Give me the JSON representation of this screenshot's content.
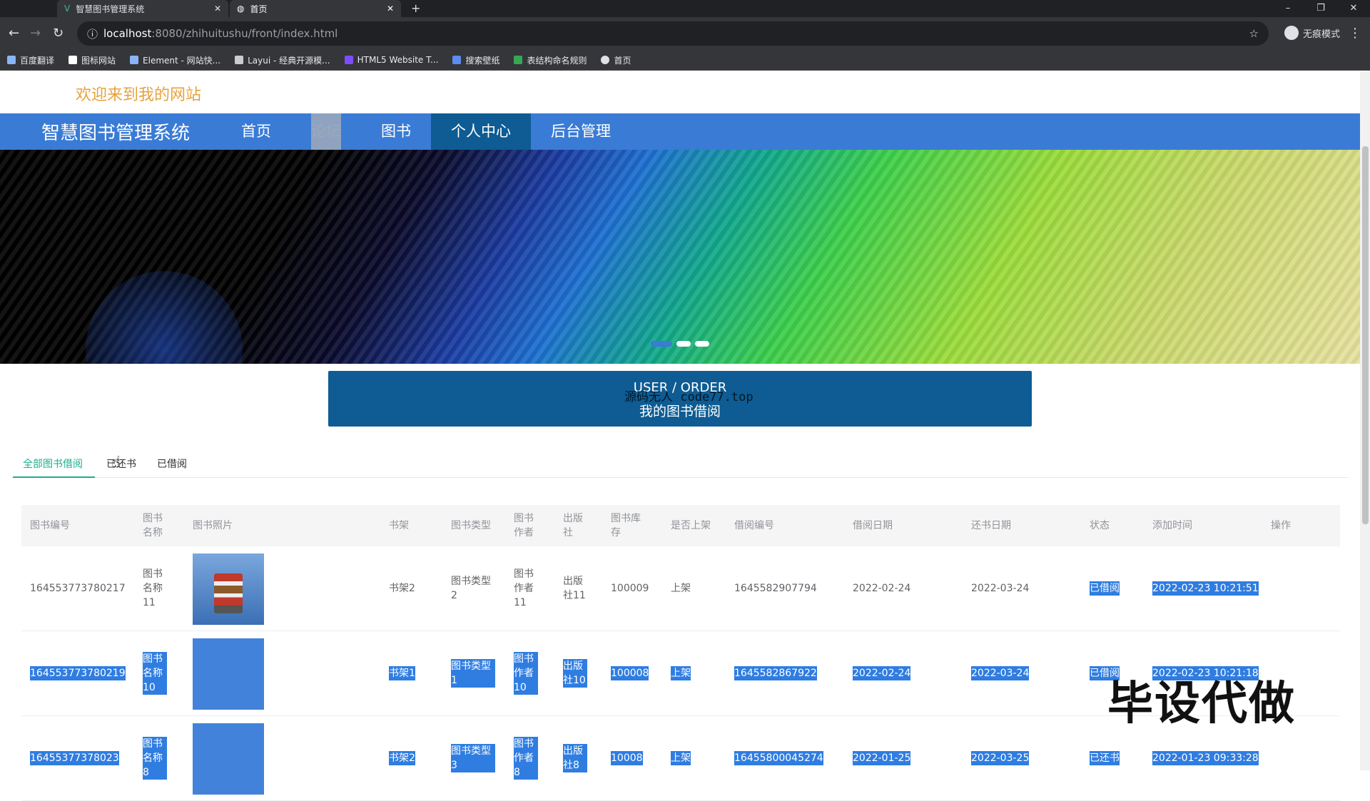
{
  "browser": {
    "tabs": [
      {
        "label": "智慧图书管理系统"
      },
      {
        "label": "首页"
      }
    ],
    "url_host": "localhost",
    "url_path": ":8080/zhihuitushu/front/index.html",
    "profile_label": "无痕模式",
    "bookmarks": [
      "百度翻译",
      "图标网站",
      "Element - 网站快...",
      "Layui - 经典开源模...",
      "HTML5 Website T...",
      "搜索壁纸",
      "表结构命名规则",
      "首页"
    ]
  },
  "header": {
    "welcome": "欢迎来到我的网站",
    "brand": "智慧图书管理系统",
    "nav": [
      "首页",
      "论坛",
      "图书",
      "个人中心",
      "后台管理"
    ]
  },
  "section": {
    "title_en": "USER / ORDER",
    "title_cn": "我的图书借阅",
    "overlay": "源码无人 code77.top"
  },
  "tabs": [
    "全部图书借阅",
    "已还书",
    "已借阅"
  ],
  "table": {
    "columns": [
      "图书编号",
      "图书名称",
      "图书照片",
      "书架",
      "图书类型",
      "图书作者",
      "出版社",
      "图书库存",
      "是否上架",
      "借阅编号",
      "借阅日期",
      "还书日期",
      "状态",
      "添加时间",
      "操作"
    ],
    "rows": [
      {
        "id": "164553773780217",
        "name": "图书名称11",
        "shelf": "书架2",
        "type": "图书类型2",
        "author": "图书作者11",
        "publisher": "出版社11",
        "stock": "100009",
        "listed": "上架",
        "borrow_no": "1645582907794",
        "borrow_date": "2022-02-24",
        "return_date": "2022-03-24",
        "status": "已借阅",
        "added": "2022-02-23 10:21:51"
      },
      {
        "id": "164553773780219",
        "name": "图书名称10",
        "shelf": "书架1",
        "type": "图书类型1",
        "author": "图书作者10",
        "publisher": "出版社10",
        "stock": "100008",
        "listed": "上架",
        "borrow_no": "1645582867922",
        "borrow_date": "2022-02-24",
        "return_date": "2022-03-24",
        "status": "已借阅",
        "added": "2022-02-23 10:21:18"
      },
      {
        "id": "16455377378023",
        "name": "图书名称8",
        "shelf": "书架2",
        "type": "图书类型3",
        "author": "图书作者8",
        "publisher": "出版社8",
        "stock": "10008",
        "listed": "上架",
        "borrow_no": "16455800045274",
        "borrow_date": "2022-01-25",
        "return_date": "2022-03-25",
        "status": "已还书",
        "added": "2022-01-23 09:33:28"
      }
    ]
  },
  "watermark": "毕设代做"
}
